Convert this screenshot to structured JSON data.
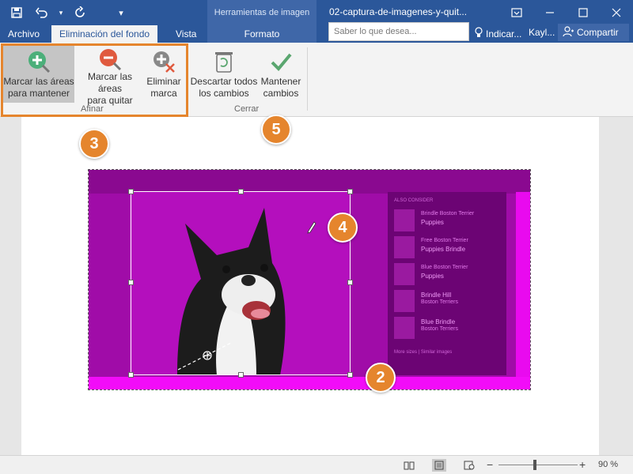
{
  "titlebar": {
    "document_title": "02-captura-de-imagenes-y-quit...",
    "context_label": "Herramientas de imagen",
    "qat": [
      "save-icon",
      "undo-icon",
      "undo-dropdown-icon",
      "redo-icon",
      "customize-qat-icon"
    ],
    "window_controls": [
      "ribbon-display-icon",
      "minimize-icon",
      "restore-icon",
      "close-icon"
    ]
  },
  "tabs": {
    "archivo": "Archivo",
    "eliminacion": "Eliminación del fondo",
    "vista": "Vista",
    "formato": "Formato"
  },
  "search": {
    "placeholder": "Saber lo que desea..."
  },
  "tellme": "Indicar...",
  "user": "Kayl...",
  "share": "Compartir",
  "ribbon": {
    "afinar": {
      "label": "Afinar",
      "buttons": [
        {
          "line1": "Marcar las áreas",
          "line2": "para mantener",
          "icon": "mark-keep-icon"
        },
        {
          "line1": "Marcar las áreas",
          "line2": "para quitar",
          "icon": "mark-remove-icon"
        },
        {
          "line1": "Eliminar",
          "line2": "marca",
          "icon": "delete-mark-icon"
        }
      ]
    },
    "cerrar": {
      "label": "Cerrar",
      "buttons": [
        {
          "line1": "Descartar todos",
          "line2": "los cambios",
          "icon": "discard-icon"
        },
        {
          "line1": "Mantener",
          "line2": "cambios",
          "icon": "keep-changes-icon"
        }
      ]
    }
  },
  "picture": {
    "panel_heading": "ALSO CONSIDER",
    "items": [
      {
        "line1": "Brindle Boston Terrier",
        "line2": "Puppies"
      },
      {
        "line1": "Free Boston Terrier",
        "line2": "Puppies Brindle"
      },
      {
        "line1": "Blue Boston Terrier",
        "line2": "Puppies"
      },
      {
        "line1": "Brindle Hill",
        "line2": "Boston Terriers"
      },
      {
        "line1": "Blue Brindle",
        "line2": "Boston Terriers"
      }
    ],
    "panel_footer": "More sizes  |  Similar images"
  },
  "callouts": [
    "2",
    "3",
    "4",
    "5"
  ],
  "statusbar": {
    "views": [
      "read-mode-icon",
      "print-layout-icon",
      "web-layout-icon"
    ],
    "zoom_minus": "−",
    "zoom_plus": "+",
    "zoom": "90 %",
    "zoom_level_percent": 90
  },
  "colors": {
    "accent": "#2b579a",
    "callout": "#e5852d",
    "removed_area": "#a00ca8"
  }
}
